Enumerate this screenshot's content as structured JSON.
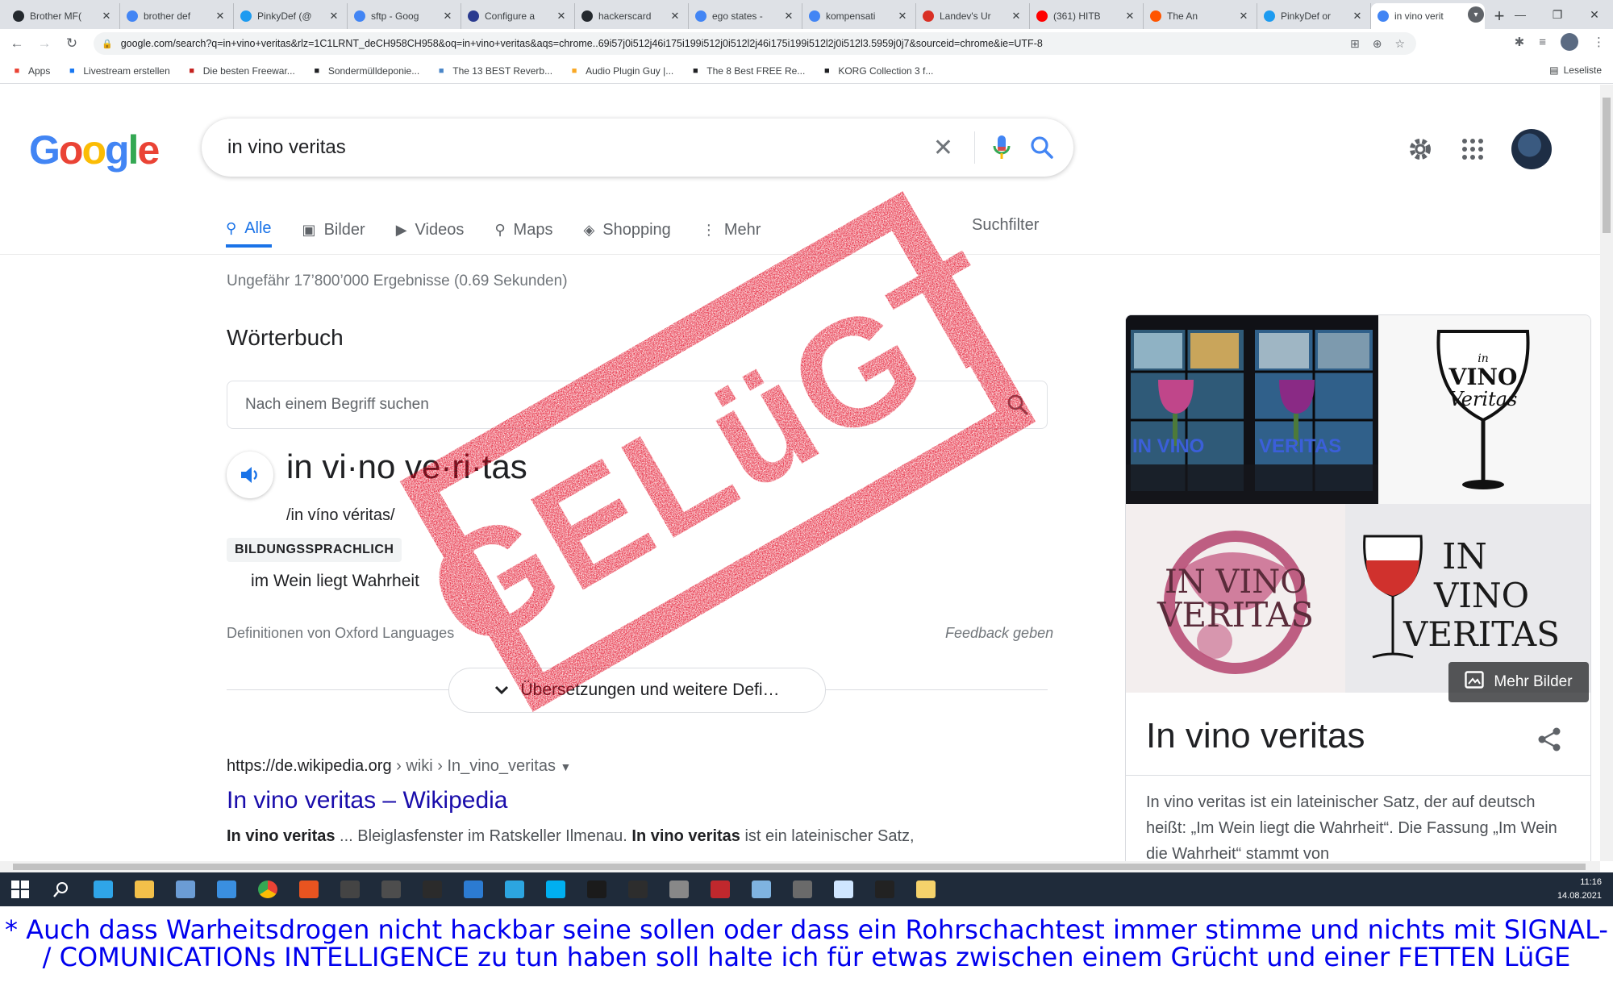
{
  "browser": {
    "tabs": [
      {
        "label": "Brother MF(",
        "fav": "github",
        "favcolor": "#24292e"
      },
      {
        "label": "brother def",
        "fav": "google",
        "favcolor": "#4285f4"
      },
      {
        "label": "PinkyDef (@",
        "fav": "twitter",
        "favcolor": "#1d9bf0"
      },
      {
        "label": "sftp - Goog",
        "fav": "google",
        "favcolor": "#4285f4"
      },
      {
        "label": "Configure a",
        "fav": "app",
        "favcolor": "#2b3b8f"
      },
      {
        "label": "hackerscard",
        "fav": "github",
        "favcolor": "#24292e"
      },
      {
        "label": "ego states -",
        "fav": "google",
        "favcolor": "#4285f4"
      },
      {
        "label": "kompensati",
        "fav": "google",
        "favcolor": "#4285f4"
      },
      {
        "label": "Landev's Ur",
        "fav": "doc",
        "favcolor": "#d93025"
      },
      {
        "label": "(361) HITB",
        "fav": "youtube",
        "favcolor": "#ff0000"
      },
      {
        "label": "The An",
        "fav": "soundcloud",
        "favcolor": "#ff5500"
      },
      {
        "label": "PinkyDef or",
        "fav": "twitter",
        "favcolor": "#1d9bf0"
      },
      {
        "label": "in vino verit",
        "fav": "google",
        "favcolor": "#4285f4",
        "active": true
      }
    ],
    "url": "google.com/search?q=in+vino+veritas&rlz=1C1LRNT_deCH958CH958&oq=in+vino+veritas&aqs=chrome..69i57j0i512j46i175i199i512j0i512l2j46i175i199i512l2j0i512l3.5959j0j7&sourceid=chrome&ie=UTF-8",
    "bookmarks": [
      {
        "label": "Apps",
        "icon": "apps-grid",
        "color": "#ea4335"
      },
      {
        "label": "Livestream erstellen",
        "icon": "facebook",
        "color": "#1877f2"
      },
      {
        "label": "Die besten Freewar...",
        "icon": "star",
        "color": "#c5221f"
      },
      {
        "label": "Sondermülldeponie...",
        "icon": "wikipedia",
        "color": "#202124"
      },
      {
        "label": "The 13 BEST Reverb...",
        "icon": "feather",
        "color": "#4a86c8"
      },
      {
        "label": "Audio Plugin Guy |...",
        "icon": "plugin",
        "color": "#f9a825"
      },
      {
        "label": "The 8 Best FREE Re...",
        "icon": "moon",
        "color": "#202124"
      },
      {
        "label": "KORG Collection 3 f...",
        "icon": "korg",
        "color": "#202124"
      }
    ],
    "reading_list": "Leseliste"
  },
  "google": {
    "logo": "Google",
    "query": "in vino veritas",
    "tabs": [
      {
        "label": "Alle",
        "icon": "search-icon",
        "active": true
      },
      {
        "label": "Bilder",
        "icon": "image-icon"
      },
      {
        "label": "Videos",
        "icon": "video-icon"
      },
      {
        "label": "Maps",
        "icon": "map-pin-icon"
      },
      {
        "label": "Shopping",
        "icon": "tag-icon"
      },
      {
        "label": "Mehr",
        "icon": "more-icon"
      }
    ],
    "suchfilter": "Suchfilter",
    "stats": "Ungefähr 17’800’000 Ergebnisse (0.69 Sekunden)",
    "dictionary": {
      "title": "Wörterbuch",
      "search_placeholder": "Nach einem Begriff suchen",
      "headword": "in vi·no ve·ri·tas",
      "pronunciation": "/in víno véritas/",
      "register": "BILDUNGSSPRACHLICH",
      "meaning": "im Wein liegt Wahrheit",
      "source": "Definitionen von Oxford Languages",
      "feedback": "Feedback geben",
      "more_button": "Übersetzungen und weitere Defi…"
    },
    "result": {
      "url_host": "https://de.wikipedia.org",
      "url_path": " › wiki › In_vino_veritas",
      "title": "In vino veritas – Wikipedia",
      "snippet_b1": "In vino veritas",
      "snippet_t1": " ... Bleiglasfenster im Ratskeller Ilmenau. ",
      "snippet_b2": "In vino veritas",
      "snippet_t2": " ist ein lateinischer Satz,"
    },
    "knowledge_panel": {
      "title": "In vino veritas",
      "more_images": "Mehr Bilder",
      "description": "In vino veritas ist ein lateinischer Satz, der auf deutsch heißt: „Im Wein liegt die Wahrheit“. Die Fassung „Im Wein die Wahrheit“ stammt von",
      "images": [
        {
          "alt": "Bleiglasfenster",
          "text_left": "IN VINO",
          "text_right": "VERITAS"
        },
        {
          "alt": "Weinglas Schriftzug",
          "text": "in vino veritas"
        },
        {
          "alt": "Weinfleck Logo",
          "text": "IN VINO VERITAS"
        },
        {
          "alt": "Weinglas Zeichnung",
          "text": "IN VINO VERITAS"
        }
      ]
    }
  },
  "stamp": {
    "text": "GELüGT",
    "color": "#e1001a"
  },
  "taskbar": {
    "time": "11:16",
    "date": "14.08.2021",
    "apps": [
      "windows-start",
      "search",
      "edge",
      "file-explorer",
      "store",
      "mail",
      "chrome",
      "ubuntu",
      "ghidra",
      "inkscape",
      "live",
      "bluetooth",
      "telegram",
      "skype",
      "terminal-app",
      "kali",
      "tool",
      "voicemeeter",
      "cloud",
      "app",
      "app2",
      "terminal",
      "notepad"
    ]
  },
  "caption": {
    "text": "* Auch dass Warheitsdrogen nicht hackbar seine sollen oder dass ein Rohrschachtest immer stimme und nichts mit SIGNAL- / COMUNICATIONs INTELLIGENCE zu tun haben soll halte ich für etwas zwischen einem Grücht und einer FETTEN LüGE"
  }
}
